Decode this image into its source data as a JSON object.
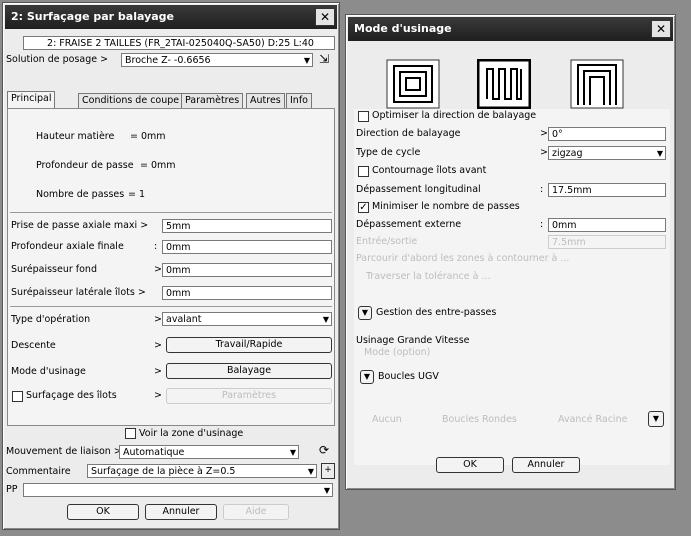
{
  "left_dialog": {
    "title": "2: Surfaçage par balayage",
    "tool": "2: FRAISE 2 TAILLES (FR_2TAI-025040Q-SA50) D:25 L:40",
    "posage": {
      "label": "Solution de posage >",
      "value": "Broche Z-  -0.6656"
    },
    "tabs": [
      "Principal",
      "Conditions de coupe",
      "Paramètres",
      "Autres",
      "Info"
    ],
    "info_rows": [
      {
        "label": "Hauteur matière",
        "value": "= 0mm"
      },
      {
        "label": "Profondeur de passe",
        "value": "= 0mm"
      },
      {
        "label": "Nombre de passes",
        "value": "= 1"
      }
    ],
    "params": [
      {
        "label": "Prise de passe axiale maxi >",
        "value": "5mm"
      },
      {
        "label": "Profondeur axiale finale",
        "value": "0mm"
      },
      {
        "label": "Surépaisseur fond",
        "value": "0mm"
      },
      {
        "label": "Surépaisseur latérale îlots >",
        "value": "0mm"
      }
    ],
    "type_operation": {
      "label": "Type d'opération",
      "value": "avalant"
    },
    "descente": {
      "label": "Descente",
      "value": "Travail/Rapide"
    },
    "mode_usinage": {
      "label": "Mode d'usinage",
      "value": "Balayage"
    },
    "surfacage_ilots": {
      "label": "Surfaçage des îlots",
      "value": "Paramètres"
    },
    "voir_zone": "Voir la zone d'usinage",
    "mouvement": {
      "label": "Mouvement de liaison >",
      "value": "Automatique"
    },
    "commentaire": {
      "label": "Commentaire",
      "value": "Surfaçage de la pièce à Z=0.5"
    },
    "pp": {
      "label": "PP",
      "value": ""
    },
    "buttons": {
      "ok": "OK",
      "cancel": "Annuler",
      "help": "Aide"
    }
  },
  "right_dialog": {
    "title": "Mode d'usinage",
    "optimiser": "Optimiser la direction de balayage",
    "direction": {
      "label": "Direction de balayage",
      "value": "0°"
    },
    "cycle": {
      "label": "Type de cycle",
      "value": "zigzag"
    },
    "contournage": "Contournage îlots avant",
    "depassement_long": {
      "label": "Dépassement longitudinal",
      "value": "17.5mm"
    },
    "minimiser": "Minimiser le nombre de passes",
    "depassement_ext": {
      "label": "Dépassement externe",
      "value": "0mm"
    },
    "disabled_row": {
      "label": "Entrée/sortie",
      "value": "7.5mm"
    },
    "disabled_line1": "Parcourir d'abord les zones à contourner à ...",
    "disabled_line2": "Traverser la tolérance à ...",
    "gestion": "Gestion des entre-passes",
    "ugv_title": "Usinage Grande Vitesse",
    "ugv_sub": "Mode (option)",
    "boucles": "Boucles UGV",
    "disabled_bottom": [
      "Aucun",
      "Boucles Rondes",
      "Avancé Racine"
    ],
    "buttons": {
      "ok": "OK",
      "cancel": "Annuler"
    }
  }
}
